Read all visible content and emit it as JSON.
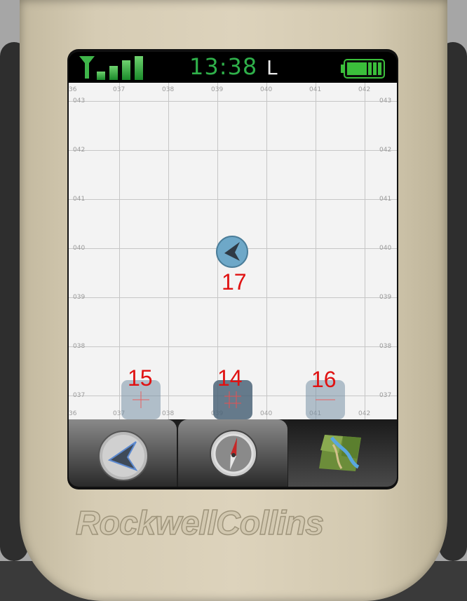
{
  "device": {
    "brand": "RockwellCollins"
  },
  "status_bar": {
    "time": "13:38",
    "time_mode": "L",
    "signal_icon": "signal-strength-icon",
    "battery_icon": "battery-full-icon",
    "signal_bars": 4,
    "battery_level": 1.0
  },
  "map": {
    "top_ticks": [
      "36",
      "037",
      "038",
      "039",
      "040",
      "041",
      "042"
    ],
    "left_ticks": [
      "043",
      "042",
      "041",
      "040",
      "039",
      "038",
      "037"
    ],
    "right_ticks": [
      "043",
      "042",
      "041",
      "040",
      "039",
      "038",
      "037"
    ],
    "bottom_ticks": [
      "36",
      "037",
      "038",
      "039",
      "040",
      "041",
      "042"
    ],
    "marker_icon": "position-arrow-icon"
  },
  "labels": {
    "marker": "17",
    "button_left": "15",
    "button_center": "14",
    "button_right": "16"
  },
  "soft_buttons": [
    {
      "name": "crosshair-button",
      "icon": "crosshair-icon"
    },
    {
      "name": "grid-button",
      "icon": "grid-icon"
    },
    {
      "name": "line-button",
      "icon": "line-icon"
    }
  ],
  "nav_tabs": [
    {
      "name": "navigation-tab",
      "icon": "navigation-arrow-icon"
    },
    {
      "name": "compass-tab",
      "icon": "compass-icon"
    },
    {
      "name": "map-tab",
      "icon": "map-icon",
      "selected": true
    }
  ],
  "colors": {
    "clock": "#2fb04a",
    "label_red": "#e01212",
    "bezel": "#d6ccb4"
  }
}
